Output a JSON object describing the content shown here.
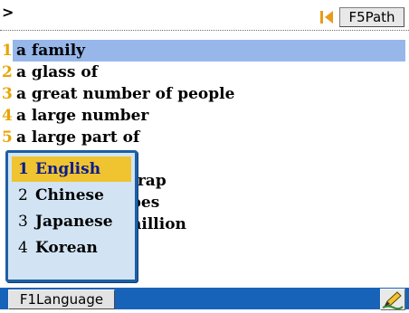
{
  "header": {
    "prompt_symbol": "⊳",
    "path_button_label": "F5Path"
  },
  "results": [
    {
      "num": "1",
      "text": "a family"
    },
    {
      "num": "2",
      "text": "a glass of"
    },
    {
      "num": "3",
      "text": "a great number of people"
    },
    {
      "num": "4",
      "text": "a large number"
    },
    {
      "num": "5",
      "text": "a large part of"
    },
    {
      "num": "",
      "text": ""
    },
    {
      "num": "",
      "text": "trap"
    },
    {
      "num": "",
      "text": "bes"
    },
    {
      "num": "",
      "text": "hillion"
    }
  ],
  "language_popup": {
    "items": [
      {
        "num": "1",
        "label": "English"
      },
      {
        "num": "2",
        "label": "Chinese"
      },
      {
        "num": "3",
        "label": "Japanese"
      },
      {
        "num": "4",
        "label": "Korean"
      }
    ],
    "selected": "English"
  },
  "footer": {
    "language_button_label": "F1Language"
  },
  "colors": {
    "selection": "#97b7ea",
    "number": "#e8a400",
    "popup_border": "#1d5fa4",
    "popup_background": "#d2e4f4",
    "popup_active": "#f0c331",
    "footer": "#1863ba"
  },
  "icons": {
    "prompt": "caret-right-icon",
    "nav": "step-back-icon",
    "pen": "pen-icon"
  }
}
